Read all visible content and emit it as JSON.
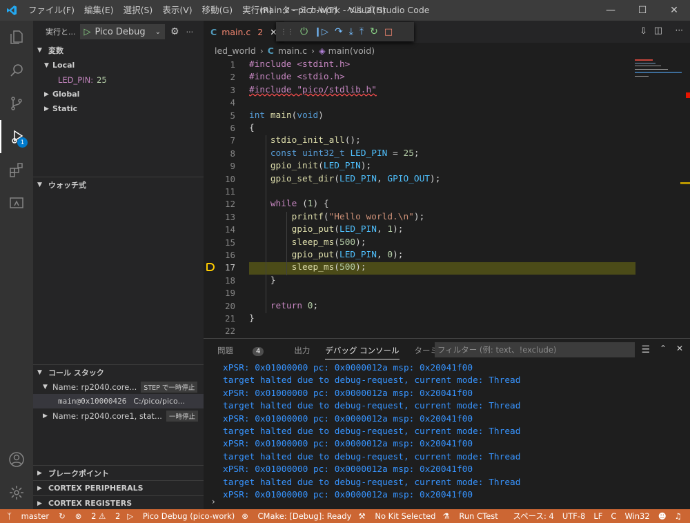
{
  "menu": [
    "ファイル(F)",
    "編集(E)",
    "選択(S)",
    "表示(V)",
    "移動(G)",
    "実行(R)",
    "ターミナル(T)",
    "ヘルプ(H)"
  ],
  "window_title": "main.c - pico-work - Visual Studio Code",
  "activity": {
    "debug_badge": "1"
  },
  "sidebar": {
    "run_label": "実行と...",
    "config": "Pico Debug",
    "variables": {
      "title": "変数",
      "local": "Local",
      "led_pin_name": "LED_PIN:",
      "led_pin_value": "25",
      "global": "Global",
      "static": "Static"
    },
    "watch": {
      "title": "ウォッチ式"
    },
    "callstack": {
      "title": "コール スタック",
      "thread0": "Name: rp2040.core...",
      "thread0_state": "STEP で一時停止",
      "frame": "main@0x10000426",
      "frame_path": "C:/pico/pico...",
      "thread1": "Name: rp2040.core1, stat...",
      "thread1_state": "一時停止"
    },
    "breakpoints": {
      "title": "ブレークポイント"
    },
    "peripherals": {
      "title": "CORTEX PERIPHERALS"
    },
    "registers": {
      "title": "CORTEX REGISTERS"
    }
  },
  "editor": {
    "tab_name": "main.c",
    "tab_problems": "2",
    "breadcrumb": [
      "led_world",
      "main.c",
      "main(void)"
    ]
  },
  "code_lines": [
    {
      "n": "1",
      "t": "#include <stdint.h>"
    },
    {
      "n": "2",
      "t": "#include <stdio.h>"
    },
    {
      "n": "3",
      "t": "#include \"pico/stdlib.h\""
    },
    {
      "n": "4",
      "t": ""
    },
    {
      "n": "5",
      "t": "int main(void)"
    },
    {
      "n": "6",
      "t": "{"
    },
    {
      "n": "7",
      "t": "    stdio_init_all();"
    },
    {
      "n": "8",
      "t": "    const uint32_t LED_PIN = 25;"
    },
    {
      "n": "9",
      "t": "    gpio_init(LED_PIN);"
    },
    {
      "n": "10",
      "t": "    gpio_set_dir(LED_PIN, GPIO_OUT);"
    },
    {
      "n": "11",
      "t": ""
    },
    {
      "n": "12",
      "t": "    while (1) {"
    },
    {
      "n": "13",
      "t": "        printf(\"Hello world.\\n\");"
    },
    {
      "n": "14",
      "t": "        gpio_put(LED_PIN, 1);"
    },
    {
      "n": "15",
      "t": "        sleep_ms(500);"
    },
    {
      "n": "16",
      "t": "        gpio_put(LED_PIN, 0);"
    },
    {
      "n": "17",
      "t": "        sleep_ms(500);"
    },
    {
      "n": "18",
      "t": "    }"
    },
    {
      "n": "19",
      "t": ""
    },
    {
      "n": "20",
      "t": "    return 0;"
    },
    {
      "n": "21",
      "t": "}"
    },
    {
      "n": "22",
      "t": ""
    }
  ],
  "panel": {
    "tabs": {
      "problems": "問題",
      "problems_count": "4",
      "output": "出力",
      "debug_console": "デバッグ コンソール",
      "terminal": "ターミナル"
    },
    "filter_placeholder": "フィルター (例: text、!exclude)",
    "lines": [
      "xPSR: 0x01000000 pc: 0x0000012a msp: 0x20041f00",
      "target halted due to debug-request, current mode: Thread",
      "xPSR: 0x01000000 pc: 0x0000012a msp: 0x20041f00",
      "target halted due to debug-request, current mode: Thread",
      "xPSR: 0x01000000 pc: 0x0000012a msp: 0x20041f00",
      "target halted due to debug-request, current mode: Thread",
      "xPSR: 0x01000000 pc: 0x0000012a msp: 0x20041f00",
      "target halted due to debug-request, current mode: Thread",
      "xPSR: 0x01000000 pc: 0x0000012a msp: 0x20041f00",
      "target halted due to debug-request, current mode: Thread",
      "xPSR: 0x01000000 pc: 0x0000012a msp: 0x20041f00"
    ]
  },
  "status": {
    "branch": "master",
    "errors": "2",
    "warnings": "2",
    "debug": "Pico Debug (pico-work)",
    "cmake": "CMake: [Debug]: Ready",
    "kit": "No Kit Selected",
    "ctest": "Run CTest",
    "spaces": "スペース: 4",
    "encoding": "UTF-8",
    "eol": "LF",
    "lang": "C",
    "platform": "Win32"
  },
  "colors": {
    "statusbar": "#cc6633",
    "current_line": "#4b4b18",
    "accent": "#007acc"
  }
}
